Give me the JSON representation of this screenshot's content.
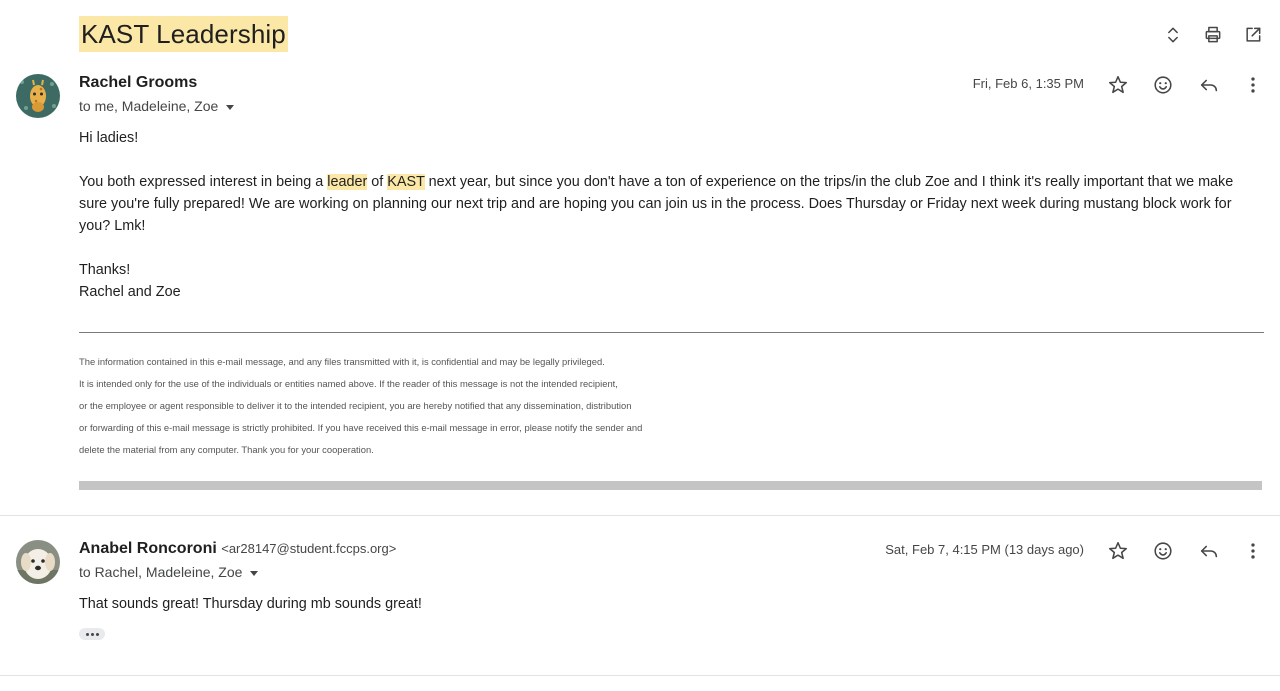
{
  "thread": {
    "subject": "KAST Leadership"
  },
  "messages": [
    {
      "sender": "Rachel Grooms",
      "recipients": "to me, Madeleine, Zoe",
      "date": "Fri, Feb 6, 1:35 PM",
      "greeting": "Hi ladies!",
      "para_pre": "You both expressed interest in being a ",
      "hl1": "leader",
      "para_mid": " of ",
      "hl2": "KAST",
      "para_post": " next year, but since you don't have a ton of experience on the trips/in the club Zoe and I think it's really important that we make sure you're fully prepared! We are working on planning our next trip and are hoping you can join us in the process. Does Thursday or Friday next week during mustang block work for you? Lmk!",
      "signoff1": "Thanks!",
      "signoff2": "Rachel and Zoe",
      "disclaimer": [
        "The information contained in this e-mail message, and any files transmitted with it, is confidential and may be legally privileged.",
        "It is intended only for the use of the individuals or entities named above. If the reader of this message is not the intended recipient,",
        "or the employee or agent responsible to deliver it to the intended recipient, you are hereby notified that any dissemination, distribution",
        "or forwarding of this e-mail message is strictly prohibited. If you have received this e-mail message in error, please notify the sender and",
        "delete the material from any computer. Thank you for your cooperation."
      ]
    },
    {
      "sender": "Anabel Roncoroni",
      "sender_email": "<ar28147@student.fccps.org>",
      "recipients": "to Rachel, Madeleine, Zoe",
      "date": "Sat, Feb 7, 4:15 PM (13 days ago)",
      "body": "That sounds great! Thursday during mb sounds great!"
    }
  ],
  "icons": {
    "top": [
      "expand-collapse-icon",
      "print-icon",
      "open-new-window-icon"
    ],
    "message_actions": [
      "star-icon",
      "emoji-icon",
      "reply-icon",
      "more-vert-icon"
    ]
  },
  "colors": {
    "highlight": "#fce8a6",
    "text": "#1f1f1f",
    "secondary": "#444746"
  }
}
